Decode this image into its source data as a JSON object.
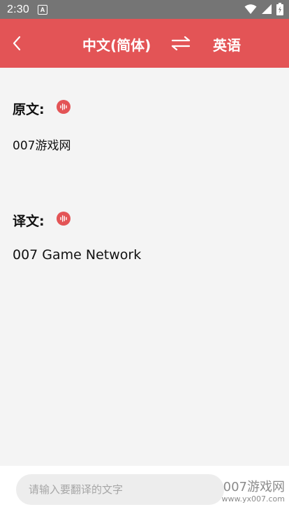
{
  "status_bar": {
    "time": "2:30",
    "notification_badge": "A"
  },
  "header": {
    "source_language": "中文(简体)",
    "target_language": "英语"
  },
  "original": {
    "label": "原文:",
    "text": "007游戏网"
  },
  "translation": {
    "label": "译文:",
    "text": "007 Game Network"
  },
  "input": {
    "placeholder": "请输入要翻译的文字"
  },
  "watermark": {
    "line1": "007游戏网",
    "line2": "www.yx007.com"
  },
  "colors": {
    "accent": "#e35456",
    "status_bar": "#757575",
    "background": "#f4f4f4"
  },
  "icons": [
    "back-arrow-icon",
    "swap-icon",
    "audio-wave-icon",
    "wifi-icon",
    "signal-icon",
    "battery-icon"
  ]
}
